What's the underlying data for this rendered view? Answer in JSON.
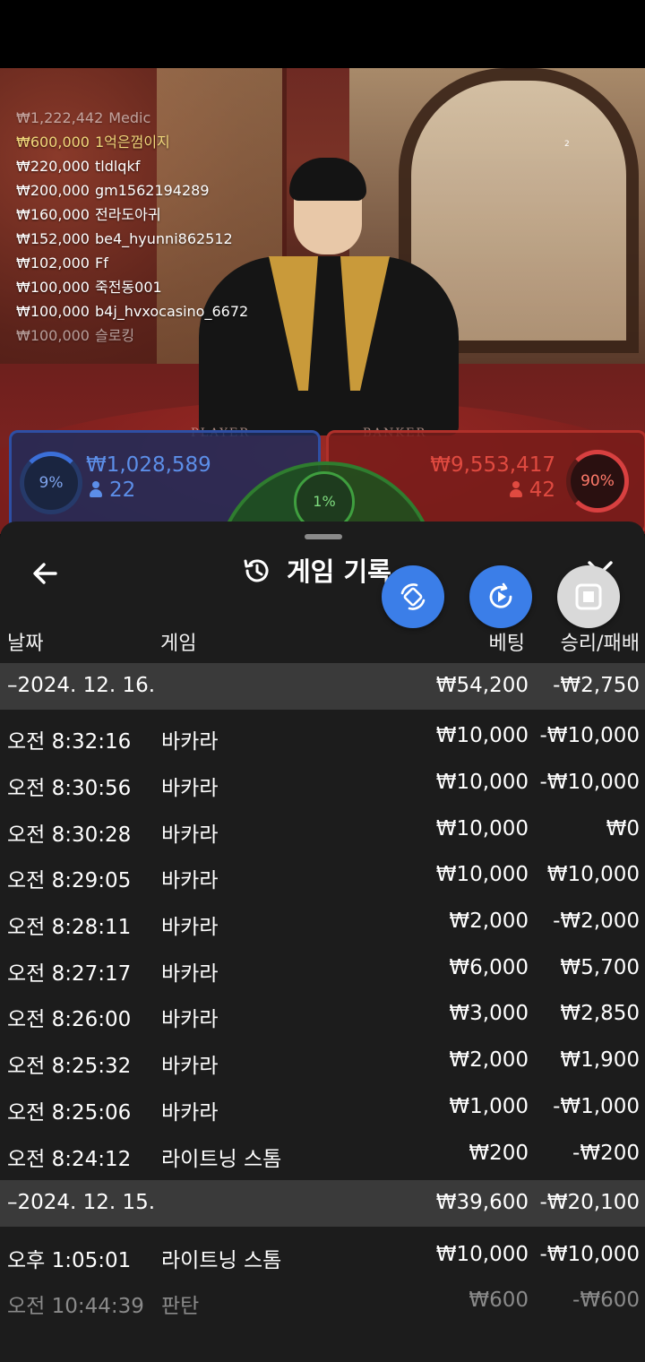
{
  "chat": [
    {
      "amount": "₩1,222,442",
      "user": "Medic",
      "style": "faded"
    },
    {
      "amount": "₩600,000",
      "user": "1억은껌이지",
      "style": "gold"
    },
    {
      "amount": "₩220,000",
      "user": "tldlqkf",
      "style": ""
    },
    {
      "amount": "₩200,000",
      "user": "gm1562194289",
      "style": ""
    },
    {
      "amount": "₩160,000",
      "user": "전라도아귀",
      "style": ""
    },
    {
      "amount": "₩152,000",
      "user": "be4_hyunni862512",
      "style": ""
    },
    {
      "amount": "₩102,000",
      "user": "Ff",
      "style": ""
    },
    {
      "amount": "₩100,000",
      "user": "죽전동001",
      "style": ""
    },
    {
      "amount": "₩100,000",
      "user": "b4j_hvxocasino_6672",
      "style": ""
    },
    {
      "amount": "₩100,000",
      "user": "슬로킹",
      "style": "faded"
    }
  ],
  "video": {
    "player_label": "PLAYER",
    "banker_label": "BANKER",
    "tiny_label": "2"
  },
  "bets": {
    "player": {
      "pct": "9%",
      "amount": "₩1,028,589",
      "count": "22",
      "color": "#3b6fd8"
    },
    "tie": {
      "pct": "1%",
      "color": "#3f9f3f"
    },
    "banker": {
      "pct": "90%",
      "amount": "₩9,553,417",
      "count": "42",
      "color": "#d84040"
    }
  },
  "sheet": {
    "title": "게임 기록",
    "columns": {
      "date": "날짜",
      "game": "게임",
      "bet": "베팅",
      "winloss": "승리/패배"
    }
  },
  "groups": [
    {
      "date": "–2024. 12. 16.",
      "bet": "₩54,200",
      "winloss": "-₩2,750",
      "rows": [
        {
          "time": "오전 8:32:16",
          "game": "바카라",
          "bet": "₩10,000",
          "winloss": "-₩10,000"
        },
        {
          "time": "오전 8:30:56",
          "game": "바카라",
          "bet": "₩10,000",
          "winloss": "-₩10,000"
        },
        {
          "time": "오전 8:30:28",
          "game": "바카라",
          "bet": "₩10,000",
          "winloss": "₩0"
        },
        {
          "time": "오전 8:29:05",
          "game": "바카라",
          "bet": "₩10,000",
          "winloss": "₩10,000"
        },
        {
          "time": "오전 8:28:11",
          "game": "바카라",
          "bet": "₩2,000",
          "winloss": "-₩2,000"
        },
        {
          "time": "오전 8:27:17",
          "game": "바카라",
          "bet": "₩6,000",
          "winloss": "₩5,700"
        },
        {
          "time": "오전 8:26:00",
          "game": "바카라",
          "bet": "₩3,000",
          "winloss": "₩2,850"
        },
        {
          "time": "오전 8:25:32",
          "game": "바카라",
          "bet": "₩2,000",
          "winloss": "₩1,900"
        },
        {
          "time": "오전 8:25:06",
          "game": "바카라",
          "bet": "₩1,000",
          "winloss": "-₩1,000"
        },
        {
          "time": "오전 8:24:12",
          "game": "라이트닝 스톰",
          "bet": "₩200",
          "winloss": "-₩200"
        }
      ]
    },
    {
      "date": "–2024. 12. 15.",
      "bet": "₩39,600",
      "winloss": "-₩20,100",
      "rows": [
        {
          "time": "오후 1:05:01",
          "game": "라이트닝 스톰",
          "bet": "₩10,000",
          "winloss": "-₩10,000"
        },
        {
          "time": "오전 10:44:39",
          "game": "판탄",
          "bet": "₩600",
          "winloss": "-₩600",
          "dim": true
        }
      ]
    }
  ],
  "icons": {
    "back": "arrow-left-icon",
    "history": "history-icon",
    "close": "chevron-down-icon",
    "fab1": "rotate-screen-icon",
    "fab2": "replay-icon",
    "fab3": "stop-icon"
  }
}
